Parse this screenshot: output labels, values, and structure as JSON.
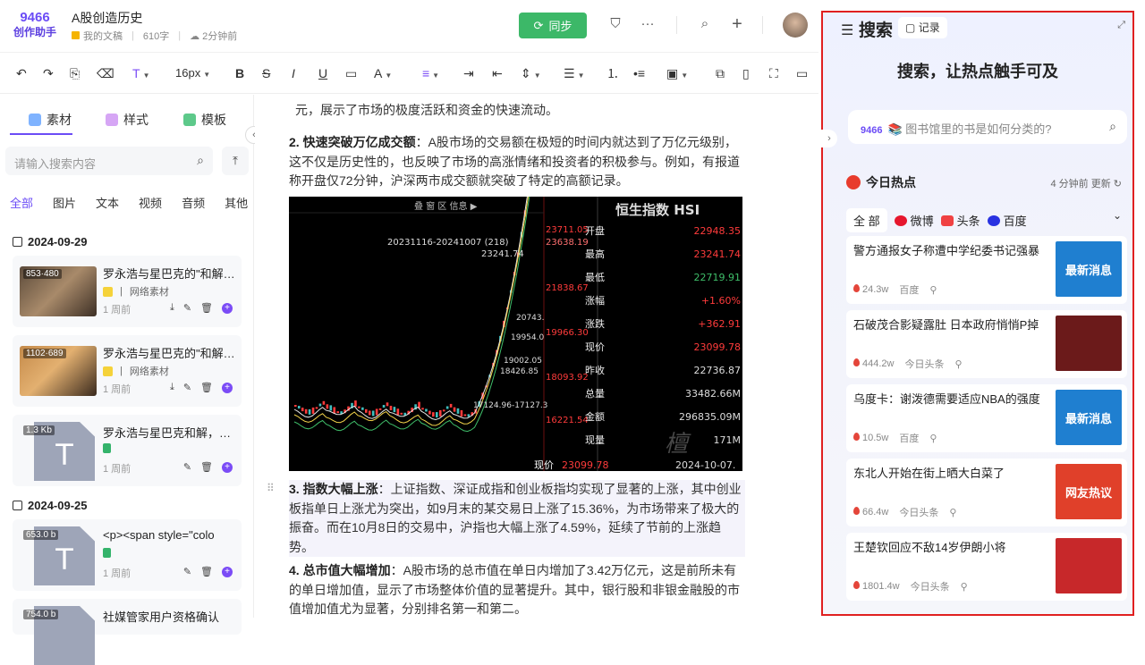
{
  "header": {
    "logo_main": "9466",
    "logo_sub": "创作助手",
    "doc_title": "A股创造历史",
    "folder": "我的文稿",
    "word_count": "610字",
    "saved": "2分钟前",
    "sync_label": "同步"
  },
  "toolbar": {
    "font_size": "16px"
  },
  "left": {
    "tabs": [
      "素材",
      "样式",
      "模板"
    ],
    "search_placeholder": "请输入搜索内容",
    "filters": [
      "全部",
      "图片",
      "文本",
      "视频",
      "音频",
      "其他"
    ],
    "groups": [
      {
        "date": "2024-09-29",
        "items": [
          {
            "title": "罗永浩与星巴克的\"和解\"...",
            "dim": "853·480",
            "source": "网络素材",
            "time": "1 周前"
          },
          {
            "title": "罗永浩与星巴克的\"和解\"...",
            "dim": "1102·689",
            "source": "网络素材",
            "time": "1 周前"
          },
          {
            "title": "罗永浩与星巴克和解，世...",
            "dim": "1.3 Kb",
            "source": "",
            "time": "1 周前"
          }
        ]
      },
      {
        "date": "2024-09-25",
        "items": [
          {
            "title": "<p><span style=\"colo",
            "dim": "653.0 b",
            "source": "",
            "time": "1 周前"
          },
          {
            "title": "社媒管家用户资格确认",
            "dim": "754.0 b",
            "source": "",
            "time": ""
          }
        ]
      }
    ]
  },
  "editor": {
    "p0": "元，展示了市场的极度活跃和资金的快速流动。",
    "p2_head": "2. 快速突破万亿成交额",
    "p2_body": "：A股市场的交易额在极短的时间内就达到了万亿元级别，这不仅是历史性的，也反映了市场的高涨情绪和投资者的积极参与。例如，有报道称开盘仅72分钟，沪深两市成交额就突破了特定的高额记录。",
    "p3_head": "3. 指数大幅上涨",
    "p3_body": "：上证指数、深证成指和创业板指均实现了显著的上涨，其中创业板指单日上涨尤为突出，如9月末的某交易日上涨了15.36%，为市场带来了极大的振奋。而在10月8日的交易中，沪指也大幅上涨了4.59%，延续了节前的上涨趋势。",
    "p4_head": "4. 总市值大幅增加",
    "p4_body": "：A股市场的总市值在单日内增加了3.42万亿元，这是前所未有的单日增加值，显示了市场整体价值的显著提升。其中，银行股和非银金融股的市值增加值尤为显著，分别排名第一和第二。"
  },
  "chart_image": {
    "top_tabs": "叠 窗 区 信息 ▶",
    "title": "恒生指数 HSI",
    "range": "20231116-20241007 (218)",
    "peak": "23241.74",
    "axis_labels": [
      "23711.05",
      "23638.19",
      "21838.67",
      "19966.30",
      "18093.92",
      "16221.54"
    ],
    "inline_labels": [
      "20743.",
      "19954.0",
      "19002.05",
      "18426.85",
      "17124.96-17127.3"
    ],
    "quote_keys": [
      "开盘",
      "最高",
      "最低",
      "涨幅",
      "涨跌",
      "现价",
      "昨收",
      "总量",
      "金额",
      "现量",
      "现价"
    ],
    "quote_vals": [
      "22948.35",
      "23241.74",
      "22719.91",
      "+1.60%",
      "+362.91",
      "23099.78",
      "22736.87",
      "33482.66M",
      "296835.09M",
      "171M",
      "23099.78"
    ],
    "footer_date": "2024-10-07.",
    "colors": {
      "up": "#ff3b3b",
      "ma1": "#ffffff",
      "ma2": "#f3d34a",
      "ma3": "#3fbf6a"
    }
  },
  "right": {
    "title": "搜索",
    "record": "记录",
    "slogan": "搜索，让热点触手可及",
    "search_placeholder": "图书馆里的书是如何分类的?",
    "search_logo": "9466",
    "hot_title": "今日热点",
    "updated": "4 分钟前 更新",
    "sources": [
      "全 部",
      "微博",
      "头条",
      "百度"
    ],
    "news": [
      {
        "title": "警方通报女子称遭中学纪委书记强暴",
        "heat": "24.3w",
        "source": "百度",
        "img_text": "最新消息",
        "img_color": "#1f7fd0"
      },
      {
        "title": "石破茂合影疑露肚 日本政府悄悄P掉",
        "heat": "444.2w",
        "source": "今日头条",
        "img_text": "",
        "img_color": "#6b1a1a"
      },
      {
        "title": "乌度卡：谢泼德需要适应NBA的强度",
        "heat": "10.5w",
        "source": "百度",
        "img_text": "最新消息",
        "img_color": "#1f7fd0"
      },
      {
        "title": "东北人开始在街上晒大白菜了",
        "heat": "66.4w",
        "source": "今日头条",
        "img_text": "网友热议",
        "img_color": "#e0402a"
      },
      {
        "title": "王楚钦回应不敌14岁伊朗小将",
        "heat": "1801.4w",
        "source": "今日头条",
        "img_text": "",
        "img_color": "#c7282a"
      }
    ]
  }
}
